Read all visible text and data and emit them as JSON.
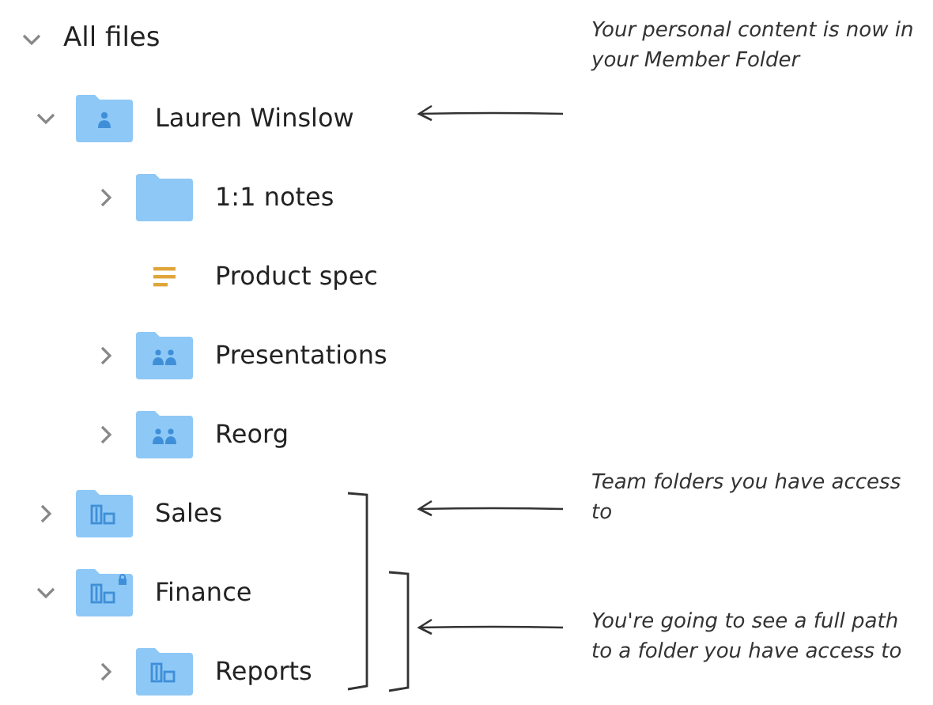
{
  "tree": {
    "label": "All files",
    "expanded": true,
    "children": [
      {
        "label": "Lauren Winslow",
        "kind": "member-folder",
        "expanded": true,
        "children": [
          {
            "label": "1:1 notes",
            "kind": "folder",
            "expanded": false
          },
          {
            "label": "Product spec",
            "kind": "document"
          },
          {
            "label": "Presentations",
            "kind": "shared-folder",
            "expanded": false
          },
          {
            "label": "Reorg",
            "kind": "shared-folder",
            "expanded": false
          }
        ]
      },
      {
        "label": "Sales",
        "kind": "team-folder",
        "expanded": false
      },
      {
        "label": "Finance",
        "kind": "locked-team-folder",
        "expanded": true,
        "children": [
          {
            "label": "Reports",
            "kind": "team-folder",
            "expanded": false
          }
        ]
      }
    ]
  },
  "notes": [
    {
      "text": "Your personal content is now in your Member Folder"
    },
    {
      "text": "Team folders you have access to"
    },
    {
      "text": "You're going to see a full path to a folder you have access to"
    }
  ]
}
